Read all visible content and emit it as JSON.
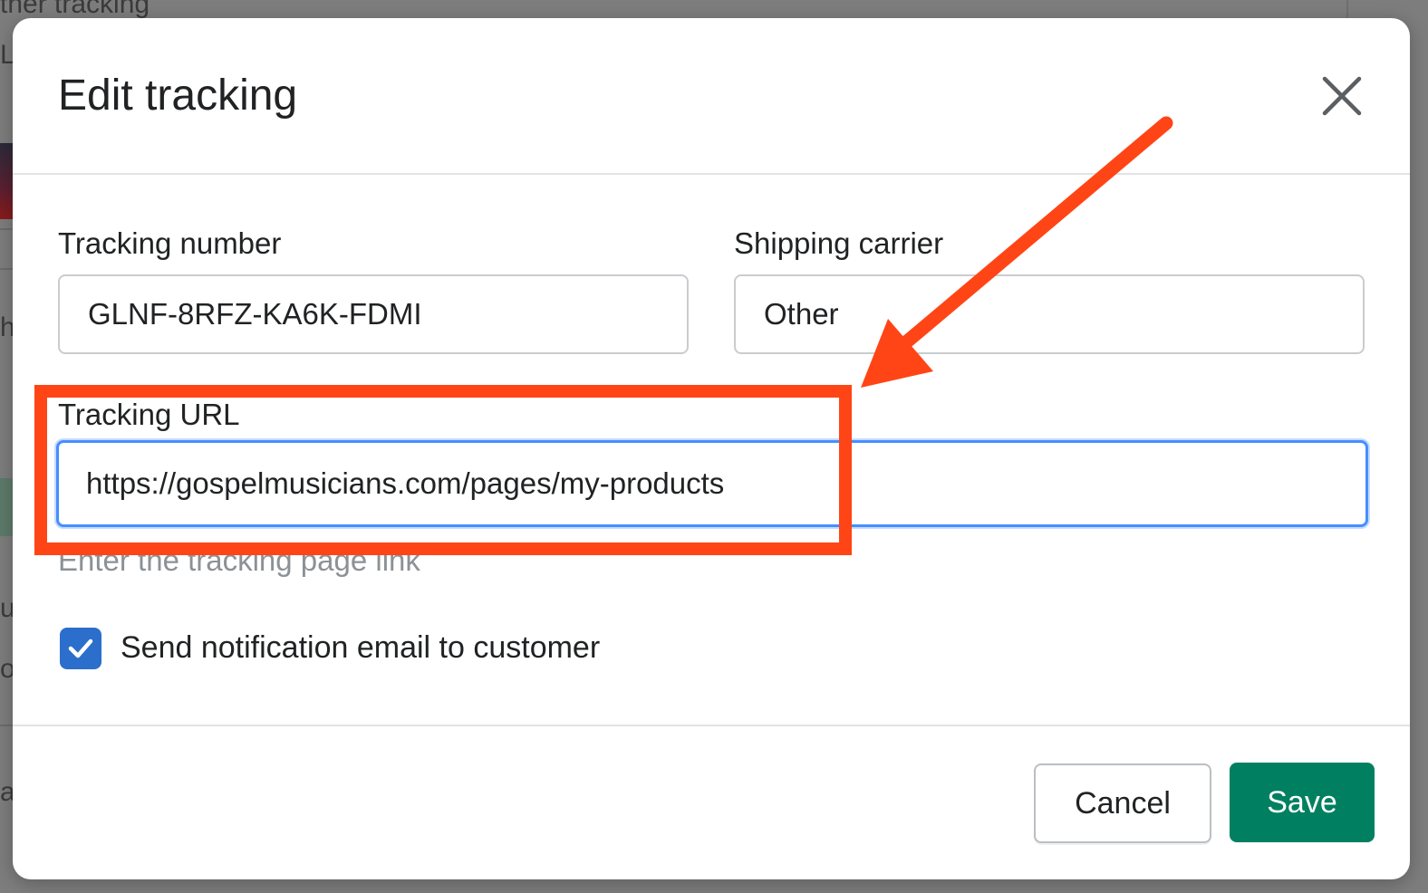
{
  "background": {
    "fragments": [
      "ther tracking",
      "L",
      "h",
      "u",
      "o",
      "a"
    ]
  },
  "modal": {
    "title": "Edit tracking",
    "close_icon": "close-icon"
  },
  "form": {
    "tracking_number": {
      "label": "Tracking number",
      "value": "GLNF-8RFZ-KA6K-FDMI"
    },
    "shipping_carrier": {
      "label": "Shipping carrier",
      "value": "Other"
    },
    "tracking_url": {
      "label": "Tracking URL",
      "value": "https://gospelmusicians.com/pages/my-products",
      "help_text": "Enter the tracking page link"
    },
    "notify_customer": {
      "label": "Send notification email to customer",
      "checked": true,
      "icon": "checkmark-icon"
    }
  },
  "footer": {
    "cancel_label": "Cancel",
    "save_label": "Save"
  },
  "colors": {
    "primary": "#008060",
    "checkbox": "#2c6ecb",
    "focus_ring": "#458fff",
    "annotation": "#ff4516"
  }
}
